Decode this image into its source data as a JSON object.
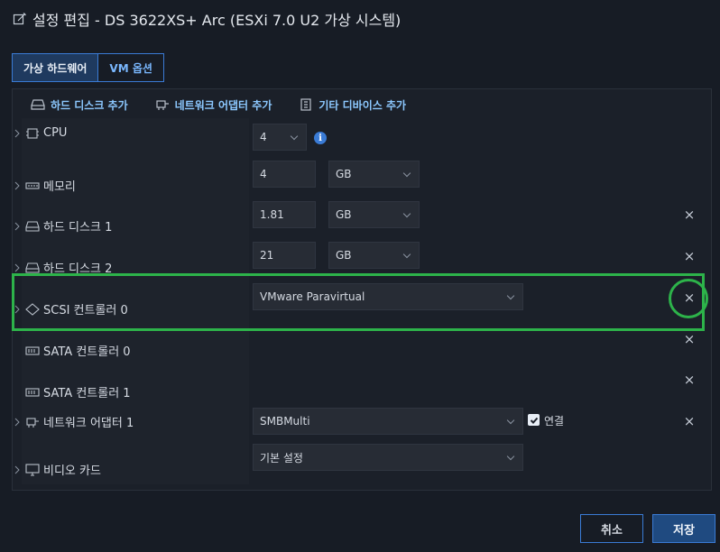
{
  "window": {
    "title": "설정 편집 - DS 3622XS+ Arc (ESXi 7.0 U2 가상 시스템)"
  },
  "tabs": [
    {
      "label": "가상 하드웨어",
      "active": true
    },
    {
      "label": "VM 옵션",
      "active": false
    }
  ],
  "toolbar": {
    "add_hard_disk": "하드 디스크 추가",
    "add_network_adapter": "네트워크 어댑터 추가",
    "add_other_device": "기타 디바이스 추가"
  },
  "devices": {
    "cpu": {
      "label": "CPU",
      "value": "4"
    },
    "memory": {
      "label": "메모리",
      "value": "4",
      "unit": "GB"
    },
    "hard_disk_1": {
      "label": "하드 디스크 1",
      "value": "1.81",
      "unit": "GB"
    },
    "hard_disk_2": {
      "label": "하드 디스크 2",
      "value": "21",
      "unit": "GB"
    },
    "scsi_controller_0": {
      "label": "SCSI 컨트롤러 0",
      "value": "VMware Paravirtual"
    },
    "sata_controller_0": {
      "label": "SATA 컨트롤러 0"
    },
    "sata_controller_1": {
      "label": "SATA 컨트롤러 1"
    },
    "network_adapter_1": {
      "label": "네트워크 어댑터 1",
      "value": "SMBMulti",
      "connect_label": "연결",
      "connected": true
    },
    "video_card": {
      "label": "비디오 카드",
      "value": "기본 설정"
    }
  },
  "remove_symbol": "×",
  "info_symbol": "i",
  "buttons": {
    "cancel": "취소",
    "save": "저장"
  },
  "colors": {
    "accent": "#3a7bd5",
    "link": "#8cc8ff",
    "highlight": "#2db34a"
  }
}
